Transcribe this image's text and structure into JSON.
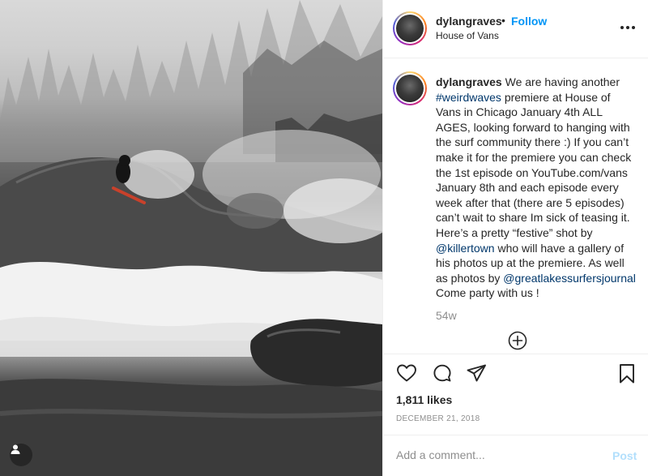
{
  "post": {
    "username": "dylangraves",
    "dot": "•",
    "follow_label": "Follow",
    "location": "House of Vans",
    "more_icon": "more-horizontal-icon"
  },
  "caption": {
    "username": "dylangraves",
    "parts": [
      {
        "text": " We are having another ",
        "type": "text"
      },
      {
        "text": "#weirdwaves",
        "type": "link"
      },
      {
        "text": " premiere at House of Vans in Chicago January 4th ALL AGES, looking forward to hanging with the surf community there :) If you can’t make it for the premiere you can check the 1st episode on YouTube.com/vans January 8th and each episode every week after that (there are 5 episodes) can’t wait to share Im sick of teasing it. Here’s a pretty “festive” shot by ",
        "type": "text"
      },
      {
        "text": "@killertown",
        "type": "link"
      },
      {
        "text": " who will have a gallery of his photos up at the premiere. As well as photos by ",
        "type": "text"
      },
      {
        "text": "@greatlakessurfersjournal",
        "type": "link"
      },
      {
        "text": " Come party with us !",
        "type": "text"
      }
    ],
    "time_ago": "54w"
  },
  "actions": {
    "like_icon": "heart-icon",
    "comment_icon": "comment-icon",
    "share_icon": "paper-plane-icon",
    "save_icon": "bookmark-icon",
    "load_more_icon": "plus-circle-icon"
  },
  "likes": "1,811 likes",
  "date": "DECEMBER 21, 2018",
  "comment": {
    "placeholder": "Add a comment...",
    "post_label": "Post"
  },
  "colors": {
    "link": "#00376b",
    "follow": "#0095f6",
    "post_disabled": "#b2dffc",
    "muted": "#8e8e8e"
  }
}
